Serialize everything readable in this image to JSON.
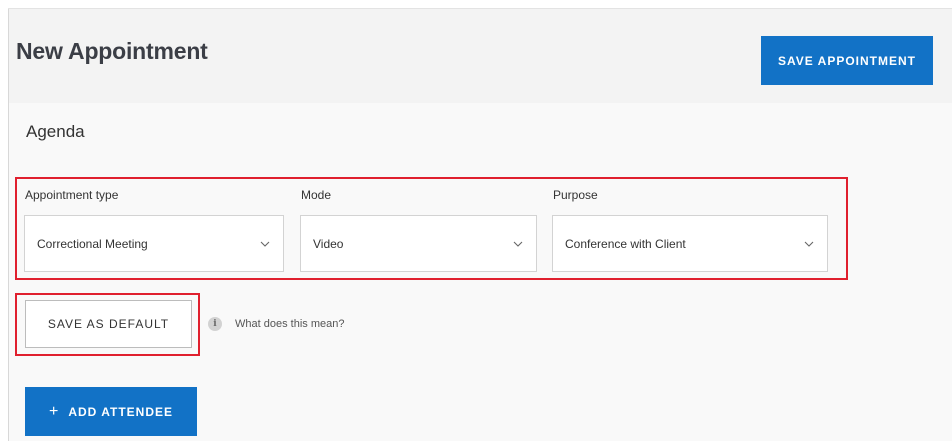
{
  "header": {
    "title": "New Appointment",
    "save_appointment_label": "SAVE APPOINTMENT"
  },
  "agenda": {
    "section_title": "Agenda",
    "fields": {
      "appointment_type": {
        "label": "Appointment type",
        "value": "Correctional Meeting"
      },
      "mode": {
        "label": "Mode",
        "value": "Video"
      },
      "purpose": {
        "label": "Purpose",
        "value": "Conference with Client"
      }
    },
    "save_default_label": "SAVE AS DEFAULT",
    "info_link_text": "What does this mean?",
    "info_icon_glyph": "i"
  },
  "attendees": {
    "add_attendee_label": "ADD ATTENDEE",
    "plus_glyph": "+"
  },
  "colors": {
    "primary": "#1272c6",
    "highlight": "#e0202e"
  }
}
